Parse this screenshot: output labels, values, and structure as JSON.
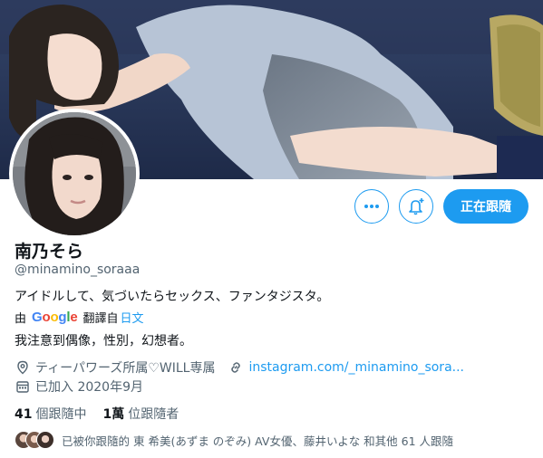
{
  "profile": {
    "name": "南乃そら",
    "handle": "@minamino_soraaa",
    "bio": "アイドルして、気づいたらセックス、ファンタジスタ。",
    "translated_bio": "我注意到偶像，性別，幻想者。",
    "location": "ティーパワーズ所属♡WILL専属",
    "website": "instagram.com/_minamino_sora...",
    "joined": "已加入 2020年9月"
  },
  "translation": {
    "prefix": "由",
    "provider": "Google",
    "suffix": "翻譯自",
    "language": "日文",
    "provider_colors": [
      "#4285f4",
      "#ea4335",
      "#fbbc05",
      "#4285f4",
      "#34a853",
      "#ea4335"
    ]
  },
  "actions": {
    "more_icon": "more-icon",
    "notify_icon": "bell-plus-icon",
    "follow_label": "正在跟隨"
  },
  "stats": {
    "following_count": "41",
    "following_label": "個跟隨中",
    "followers_count": "1萬",
    "followers_label": "位跟隨者"
  },
  "followed_by": "已被你跟隨的 東 希美(あずま のぞみ) AV女優、藤井いよな 和其他 61 人跟隨",
  "colors": {
    "accent": "#1d9bf0",
    "text": "#0f1419",
    "secondary": "#536471"
  }
}
